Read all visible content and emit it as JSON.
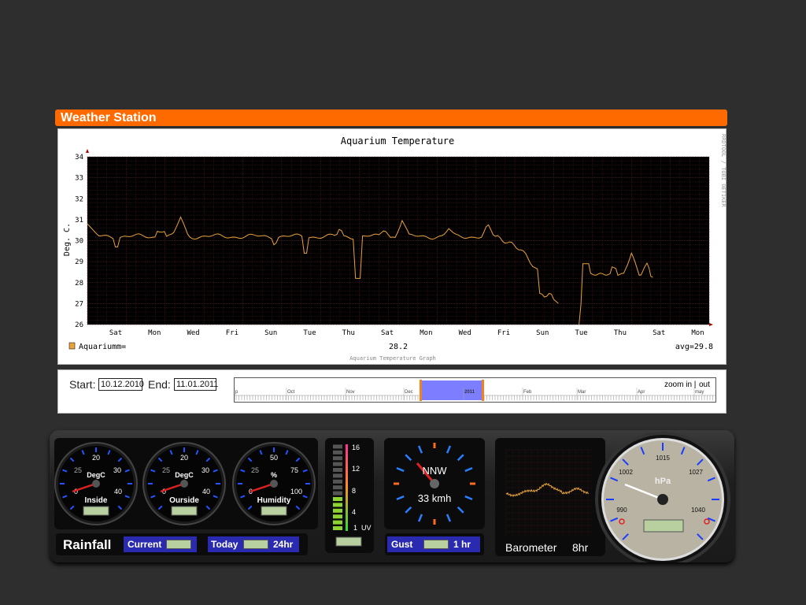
{
  "app": {
    "title": "Weather Station"
  },
  "chart": {
    "watermark": "RRDTOOL / TOBI OETIKER",
    "legend_label": "Aquariumm=",
    "current_value": "28.2",
    "average": "avg=29.8",
    "footer": "Aquarium Temperature Graph"
  },
  "chart_data": {
    "type": "line",
    "title": "Aquarium Temperature",
    "ylabel": "Deg. C.",
    "ylim": [
      26,
      34
    ],
    "yticks": [
      26,
      27,
      28,
      29,
      30,
      31,
      32,
      33,
      34
    ],
    "xticks": [
      "Sat",
      "Mon",
      "Wed",
      "Fri",
      "Sun",
      "Tue",
      "Thu",
      "Sat",
      "Mon",
      "Wed",
      "Fri",
      "Sun",
      "Tue",
      "Thu",
      "Sat",
      "Mon"
    ],
    "xrange_days": [
      0,
      32
    ],
    "grid": true,
    "series": [
      {
        "name": "Aquariumm",
        "color": "#e8a33c",
        "segments": [
          {
            "x": [
              0.0,
              0.2,
              0.5,
              0.8,
              1.2,
              1.4,
              1.5,
              1.6,
              1.8,
              2.2,
              2.6,
              3.0,
              3.5,
              3.8,
              4.0,
              4.2,
              4.5,
              4.8,
              5.0,
              5.2,
              5.5,
              5.8,
              6.0,
              6.3,
              6.7,
              7.0,
              7.5,
              8.0,
              8.5,
              9.0,
              9.5,
              10.0,
              10.5,
              11.0,
              11.2,
              11.3,
              11.4,
              11.8,
              12.2,
              12.6,
              13.0,
              13.5,
              13.8,
              13.9,
              14.0,
              14.2,
              14.6,
              15.0,
              15.5,
              16.0,
              16.4,
              16.9,
              17.2,
              17.5,
              18.0,
              18.5,
              19.0,
              19.5,
              20.0,
              20.4,
              20.8,
              21.2,
              21.6,
              22.0,
              22.5,
              22.8,
              23.2,
              23.6,
              24.0,
              24.5,
              25.0,
              25.3,
              25.7,
              26.0,
              26.3,
              26.6,
              27.0,
              27.3,
              27.6,
              27.9,
              28.2,
              28.5,
              28.8,
              29.1,
              29.4,
              29.7,
              30.0,
              30.3,
              30.6,
              30.9,
              31.3,
              31.6,
              32.0,
              32.4,
              32.8,
              33.2,
              33.5,
              33.8,
              34.2,
              34.6,
              35.0,
              35.3,
              35.6,
              35.9,
              36.2,
              36.5,
              36.8,
              37.0
            ],
            "y": [
              30.8,
              30.5,
              30.2,
              30.3,
              30.2,
              30.25,
              30.3,
              30.3,
              29.9,
              30.2,
              30.3,
              30.25,
              30.2,
              30.3,
              30.4,
              30.3,
              30.2,
              30.5,
              30.8,
              30.5,
              30.2,
              30.3,
              30.2,
              30.3,
              30.5,
              31.3,
              31.1,
              30.4,
              30.2,
              30.3,
              30.1,
              30.2,
              30.3,
              30.25,
              29.8,
              30.3,
              30.0,
              30.2,
              29.9,
              30.3,
              30.1,
              30.2,
              30.0,
              30.2,
              29.7,
              30.3,
              30.1,
              30.3,
              30.0,
              30.2,
              30.3,
              30.2,
              29.4,
              30.2,
              30.2,
              30.3,
              30.2,
              30.1,
              30.3,
              30.2,
              30.25,
              30.3,
              30.2,
              30.0,
              30.3,
              30.2,
              30.2,
              30.15,
              30.0,
              30.3,
              30.2,
              30.3,
              30.25,
              30.3,
              30.2,
              30.1,
              30.3,
              30.4,
              30.2,
              30.3,
              30.25,
              30.3,
              30.2,
              30.15,
              30.3,
              30.2,
              30.2,
              30.3,
              30.1,
              30.3,
              30.2,
              30.3,
              30.2,
              30.2,
              30.3,
              30.2,
              30.3,
              30.2,
              30.2,
              30.3,
              30.2,
              30.2,
              30.3,
              30.2,
              30.3,
              30.2,
              30.25,
              30.2
            ],
            "note": "shape only"
          }
        ]
      }
    ]
  },
  "range": {
    "start_label": "Start:",
    "start_value": "10.12.2010",
    "end_label": "End:",
    "end_value": "11.01.2011",
    "zoom_in": "zoom in",
    "separator": "|",
    "zoom_out": "out",
    "months": [
      "p",
      "Oct",
      "Nov",
      "Dec",
      "2011",
      "Feb",
      "Mar",
      "Apr",
      "may"
    ]
  },
  "gauges": {
    "inside": {
      "label": "Inside",
      "unit": "DegC",
      "ticks": [
        "0",
        "20",
        "25",
        "30",
        "40"
      ]
    },
    "outside": {
      "label": "Ourside",
      "unit": "DegC",
      "ticks": [
        "0",
        "20",
        "25",
        "30",
        "40"
      ]
    },
    "humidity": {
      "label": "Humidity",
      "unit": "%",
      "ticks": [
        "0",
        "50",
        "25",
        "75",
        "100"
      ]
    },
    "uv": {
      "ticks": [
        "16",
        "12",
        "8",
        "4",
        "1"
      ],
      "unit": "UV",
      "lit_segments": 6,
      "total_segments": 15
    },
    "wind": {
      "direction": "NNW",
      "speed": "33 kmh"
    },
    "barometer": {
      "unit": "hPa",
      "ticks": [
        "1015",
        "1002",
        "1027",
        "990",
        "1040"
      ],
      "label": "Barometer",
      "period": "8hr"
    }
  },
  "rainfall": {
    "title": "Rainfall",
    "current": "Current",
    "today": "Today",
    "period": "24hr"
  },
  "gust": {
    "label": "Gust",
    "period": "1 hr"
  },
  "colors": {
    "accent": "#ff6a00",
    "line": "#e8a33c",
    "blue": "#2a2ab0"
  }
}
